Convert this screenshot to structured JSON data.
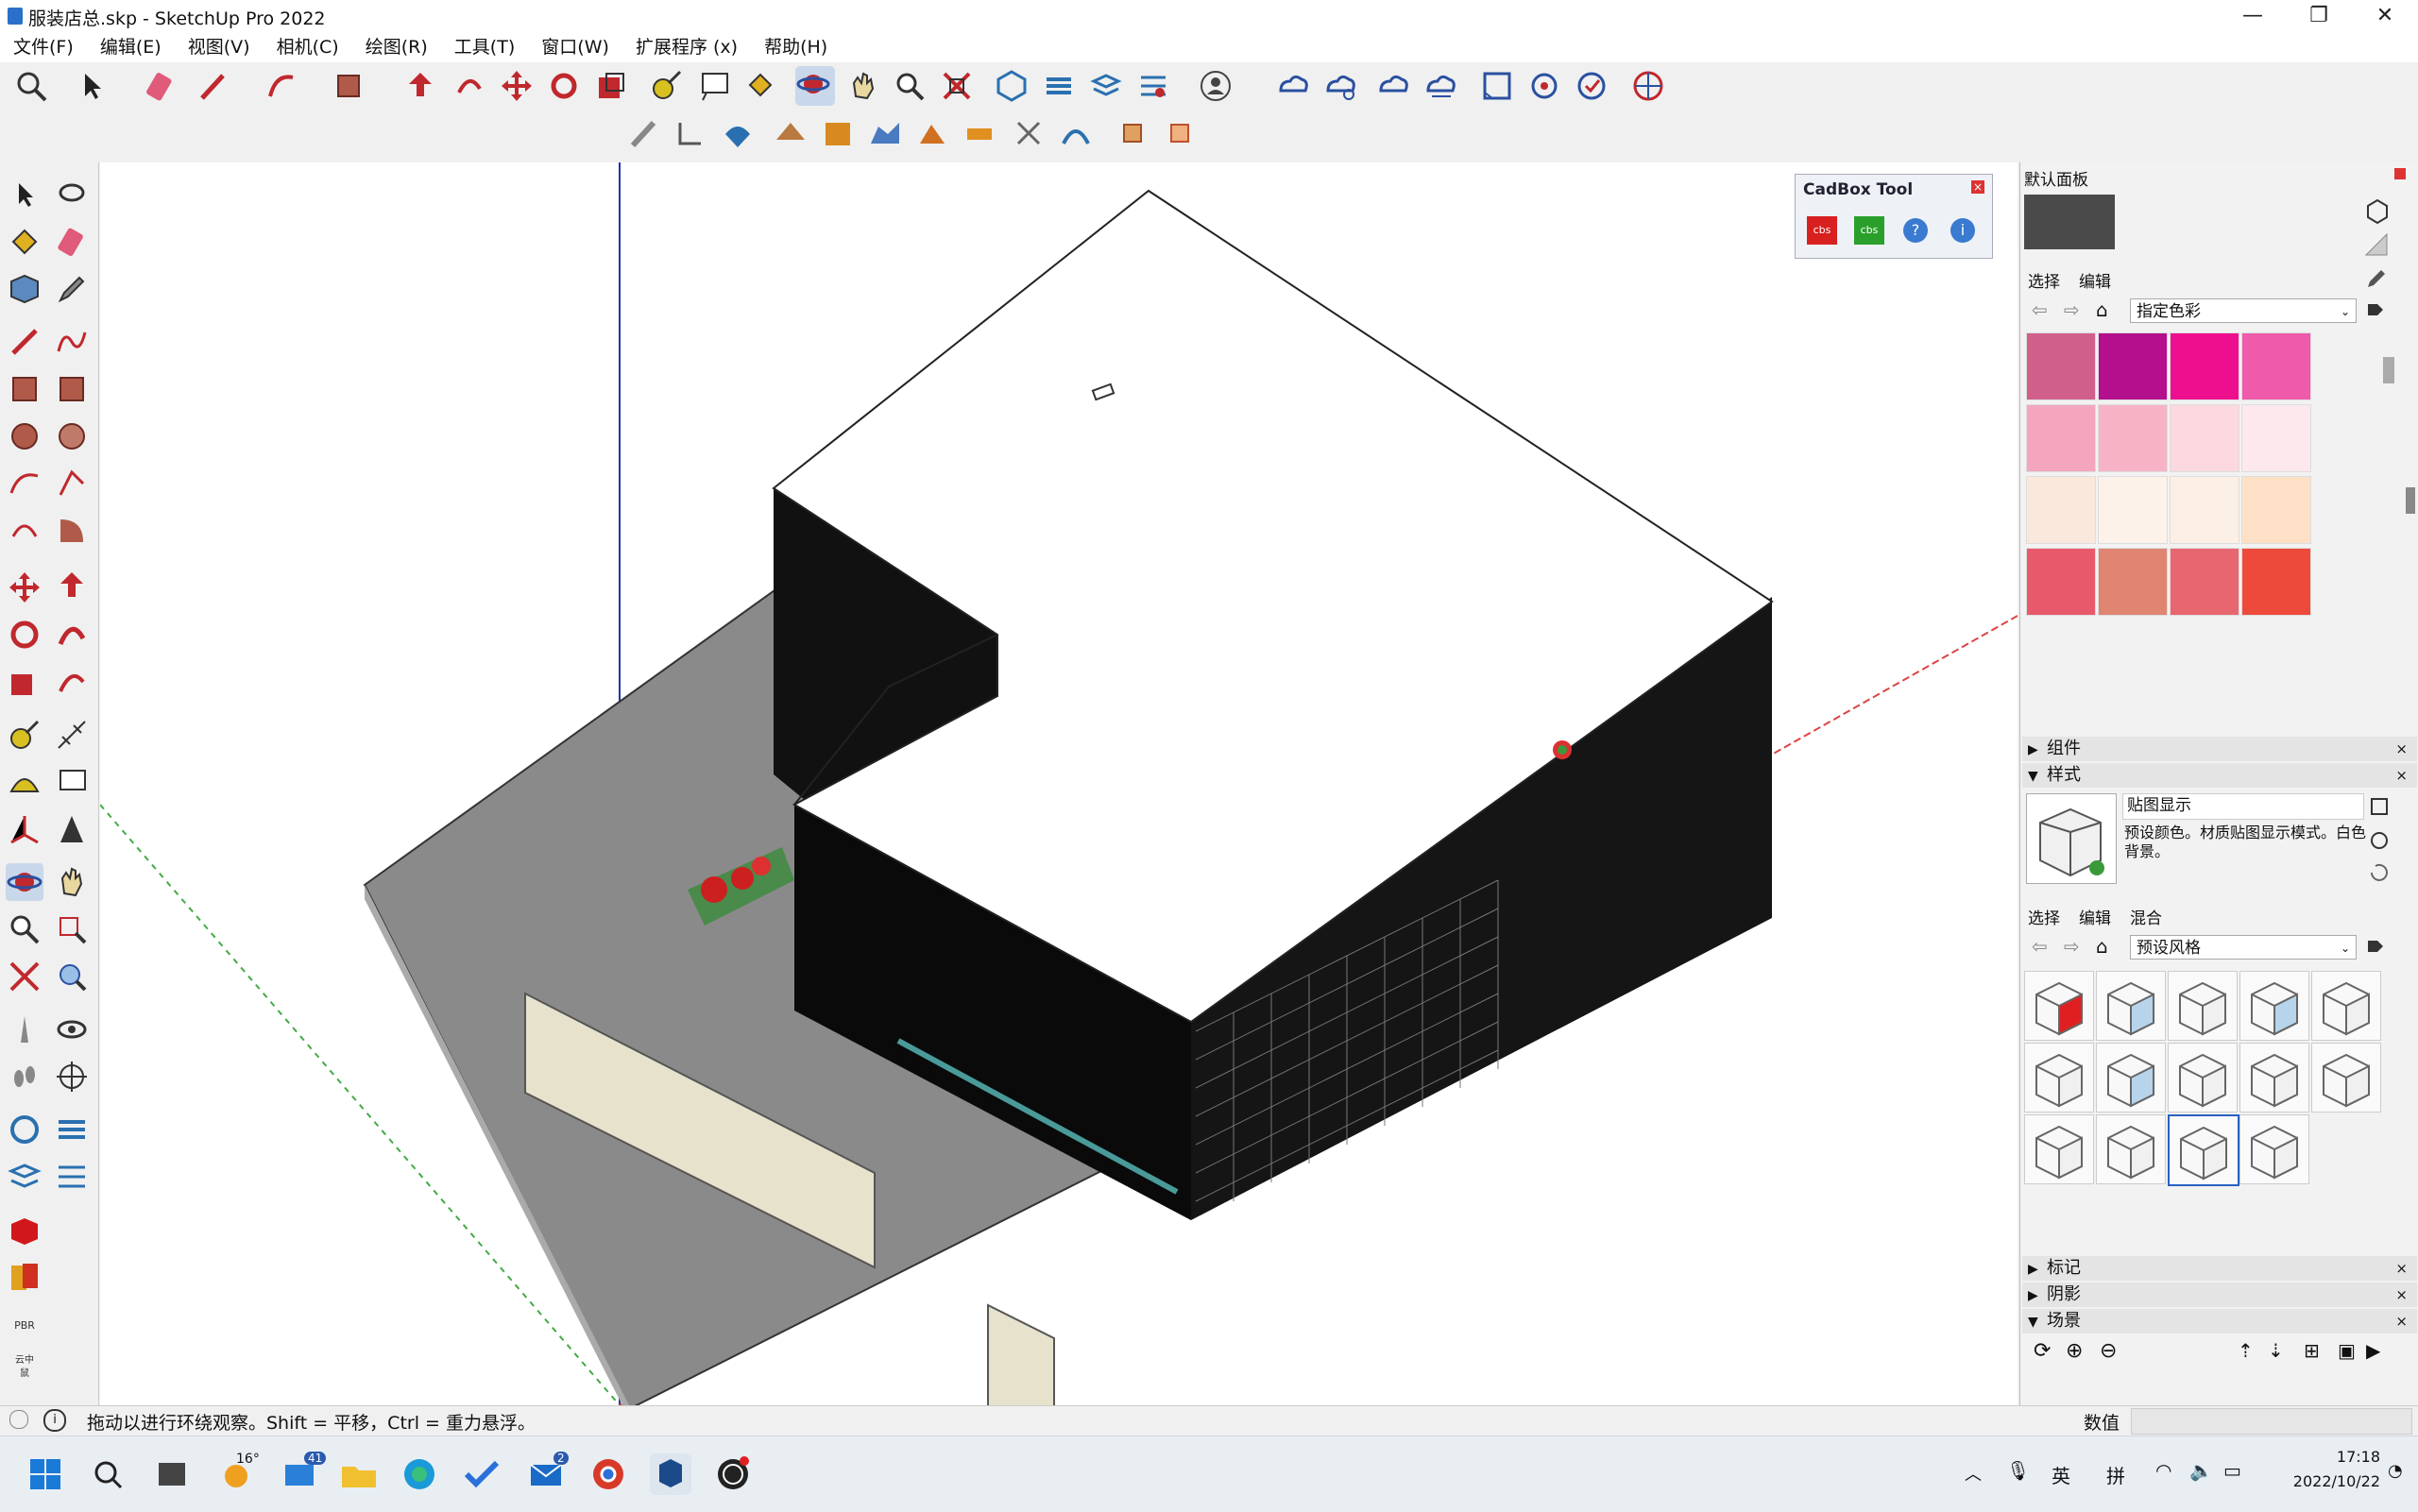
{
  "window": {
    "title": "服装店总.skp - SketchUp Pro 2022",
    "minimize": "—",
    "restore": "❐",
    "close": "✕"
  },
  "menus": [
    "文件(F)",
    "编辑(E)",
    "视图(V)",
    "相机(C)",
    "绘图(R)",
    "工具(T)",
    "窗口(W)",
    "扩展程序 (x)",
    "帮助(H)"
  ],
  "cadbox": {
    "title": "CadBox Tool",
    "close": "×",
    "buttons": [
      {
        "icon": "cbs-export-icon",
        "label": "cbs"
      },
      {
        "icon": "cbs-import-icon",
        "label": "cbs"
      },
      {
        "icon": "help-icon",
        "label": "?"
      },
      {
        "icon": "info-icon",
        "label": "i"
      }
    ]
  },
  "tray": {
    "title": "默认面板",
    "materials": {
      "tabs": [
        "选择",
        "编辑"
      ],
      "dropdown": "指定色彩",
      "current_color": "#4a4a4a",
      "swatches": [
        "#d0608a",
        "#b40f8c",
        "#ee0f8e",
        "#ef5aaa",
        "#f3a6be",
        "#f7b3c6",
        "#fbd9df",
        "#fde8ee",
        "#fbe8dc",
        "#fdf2ea",
        "#fcefe6",
        "#fde0c6",
        "#e8596b",
        "#e08572",
        "#e86670",
        "#ee4a3c",
        "#c8414e",
        "#96202c",
        "#c81038",
        "#e80f0f",
        "#8a0c12",
        "#7a0a0a",
        "#a80a1c",
        "#ee4a10"
      ]
    },
    "sections": {
      "components": "组件",
      "styles": "样式",
      "tags": "标记",
      "shadows": "阴影",
      "scenes": "场景"
    },
    "style_panel": {
      "name": "贴图显示",
      "description": "预设颜色。材质贴图显示模式。白色背景。",
      "tabs": [
        "选择",
        "编辑",
        "混合"
      ],
      "dropdown": "预设风格"
    }
  },
  "status": {
    "message": "拖动以进行环绕观察。Shift = 平移，Ctrl = 重力悬浮。",
    "measurements_label": "数值",
    "measurements_value": ""
  },
  "taskbar": {
    "weather": "16°",
    "mail_badge": "41",
    "app_badge": "2",
    "lang1": "英",
    "lang2": "拼",
    "time": "17:18",
    "date": "2022/10/22"
  },
  "left_tools": [
    "pink-tool-label-pbr",
    "cloud-tool-label"
  ],
  "left_tool_labels": {
    "pbr": "PBR",
    "cloud": "云中\n鼠"
  }
}
